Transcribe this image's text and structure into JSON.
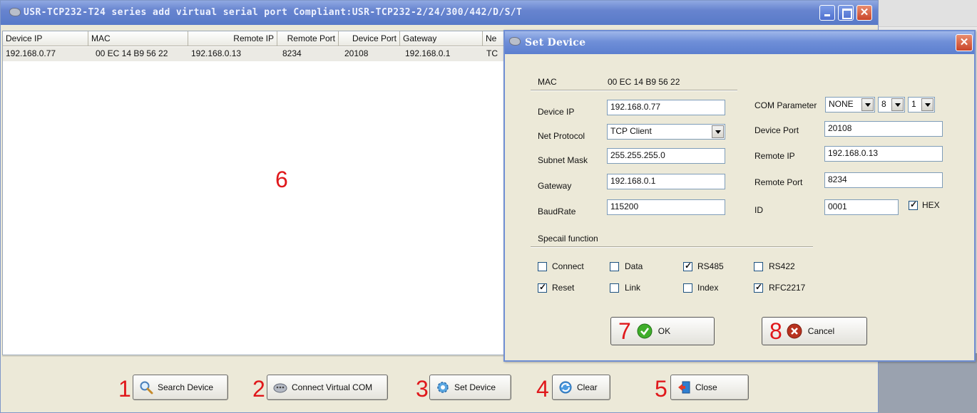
{
  "main_window": {
    "title": "USR-TCP232-T24 series add virtual serial port   Compliant:USR-TCP232-2/24/300/442/D/S/T"
  },
  "device_table": {
    "columns": [
      "Device IP",
      "MAC",
      "Remote IP",
      "Remote Port",
      "Device Port",
      "Gateway",
      "Ne"
    ],
    "rows": [
      [
        "192.168.0.77",
        "00 EC 14 B9 56 22",
        "192.168.0.13",
        "8234",
        "20108",
        "192.168.0.1",
        "TC"
      ]
    ]
  },
  "annotations": {
    "n1": "1",
    "n2": "2",
    "n3": "3",
    "n4": "4",
    "n5": "5",
    "n6": "6",
    "n7": "7",
    "n8": "8"
  },
  "toolbar": {
    "search_device": "Search Device",
    "connect_virtual_com": "Connect Virtual COM",
    "set_device": "Set Device",
    "clear": "Clear",
    "close": "Close"
  },
  "dialog": {
    "title": "Set Device",
    "mac_label": "MAC",
    "mac_value": "00 EC 14 B9 56 22",
    "device_ip_label": "Device IP",
    "device_ip_value": "192.168.0.77",
    "net_protocol_label": "Net Protocol",
    "net_protocol_value": "TCP Client",
    "subnet_mask_label": "Subnet Mask",
    "subnet_mask_value": "255.255.255.0",
    "gateway_label": "Gateway",
    "gateway_value": "192.168.0.1",
    "baudrate_label": "BaudRate",
    "baudrate_value": "115200",
    "com_parameter_label": "COM Parameter",
    "com_parity": "NONE",
    "com_databits": "8",
    "com_stopbits": "1",
    "device_port_label": "Device Port",
    "device_port_value": "20108",
    "remote_ip_label": "Remote IP",
    "remote_ip_value": "192.168.0.13",
    "remote_port_label": "Remote Port",
    "remote_port_value": "8234",
    "id_label": "ID",
    "id_value": "0001",
    "hex_label": "HEX",
    "hex_checked": true,
    "special_function_label": "Specail function",
    "checkboxes": {
      "connect": {
        "label": "Connect",
        "checked": false
      },
      "data": {
        "label": "Data",
        "checked": false
      },
      "rs485": {
        "label": "RS485",
        "checked": true
      },
      "rs422": {
        "label": "RS422",
        "checked": false
      },
      "reset": {
        "label": "Reset",
        "checked": true
      },
      "link": {
        "label": "Link",
        "checked": false
      },
      "index": {
        "label": "Index",
        "checked": false
      },
      "rfc2217": {
        "label": "RFC2217",
        "checked": true
      }
    },
    "ok_label": "OK",
    "cancel_label": "Cancel"
  },
  "colors": {
    "annotation_red": "#e0181b",
    "title_blue": "#6784cf",
    "ok_green": "#3fae2a",
    "cancel_red": "#b8321f"
  }
}
